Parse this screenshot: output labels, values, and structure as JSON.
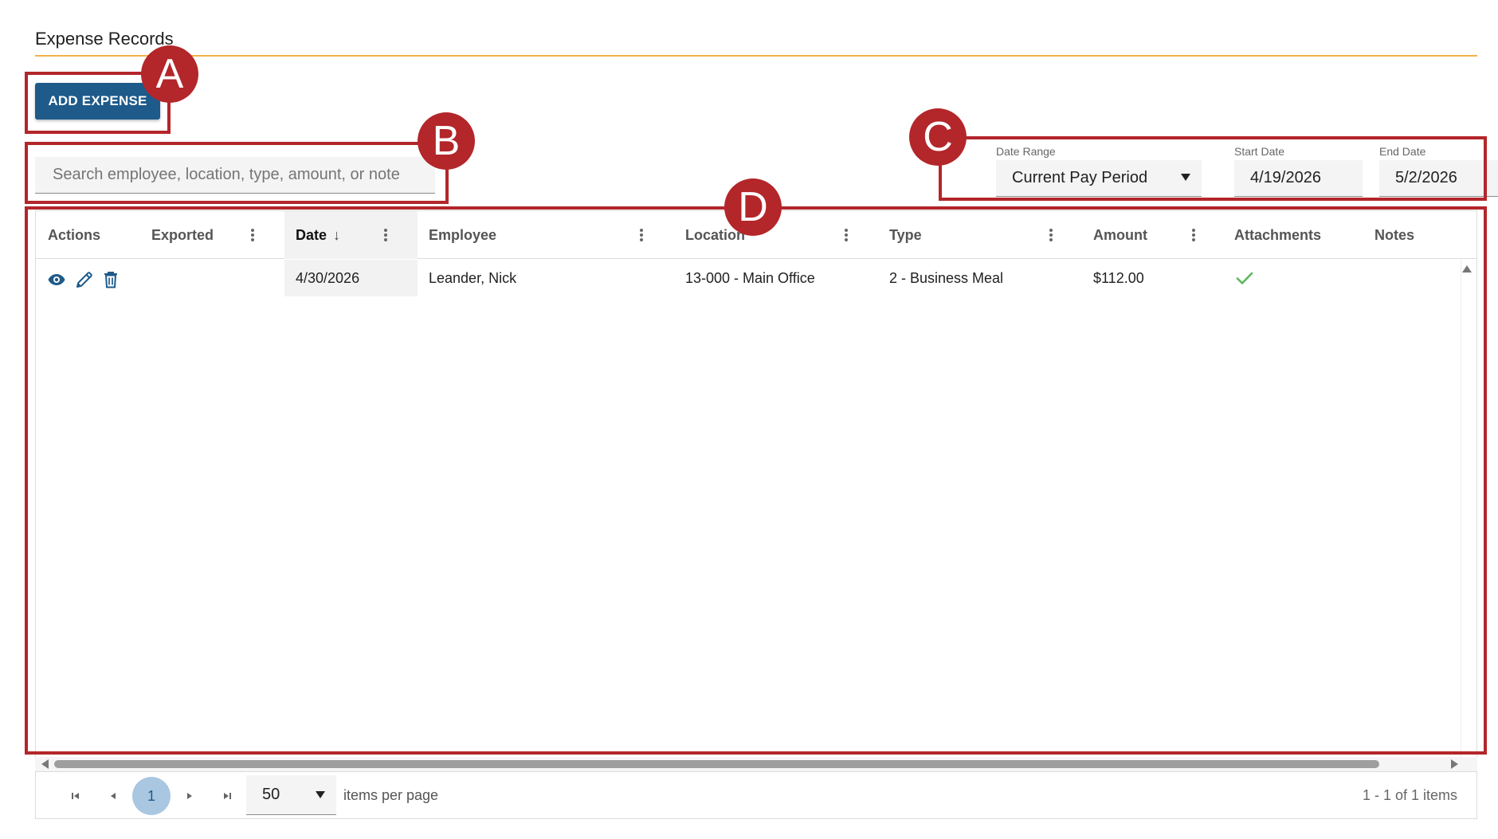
{
  "page": {
    "title": "Expense Records"
  },
  "toolbar": {
    "add_label": "ADD EXPENSE"
  },
  "search": {
    "placeholder": "Search employee, location, type, amount, or note",
    "value": ""
  },
  "filters": {
    "date_range": {
      "label": "Date Range",
      "value": "Current Pay Period"
    },
    "start_date": {
      "label": "Start Date",
      "value": "4/19/2026"
    },
    "end_date": {
      "label": "End Date",
      "value": "5/2/2026"
    }
  },
  "grid": {
    "columns": [
      "Actions",
      "Exported",
      "Date",
      "Employee",
      "Location",
      "Type",
      "Amount",
      "Attachments",
      "Notes"
    ],
    "sort": {
      "column": "Date",
      "direction": "descending",
      "arrow": "↓"
    },
    "rows": [
      {
        "exported": "",
        "date": "4/30/2026",
        "employee": "Leander, Nick",
        "location": "13-000 - Main Office",
        "type": "2 - Business Meal",
        "amount": "$112.00",
        "attachments": true,
        "notes": ""
      }
    ]
  },
  "pager": {
    "current_page": "1",
    "page_size": "50",
    "page_size_label": "items per page",
    "summary": "1 - 1 of 1 items"
  },
  "callouts": [
    "A",
    "B",
    "C",
    "D"
  ],
  "colors": {
    "primary": "#1e5a8a",
    "accent_rule": "#f5b14a",
    "callout": "#b3262a",
    "check": "#5cb85c"
  }
}
